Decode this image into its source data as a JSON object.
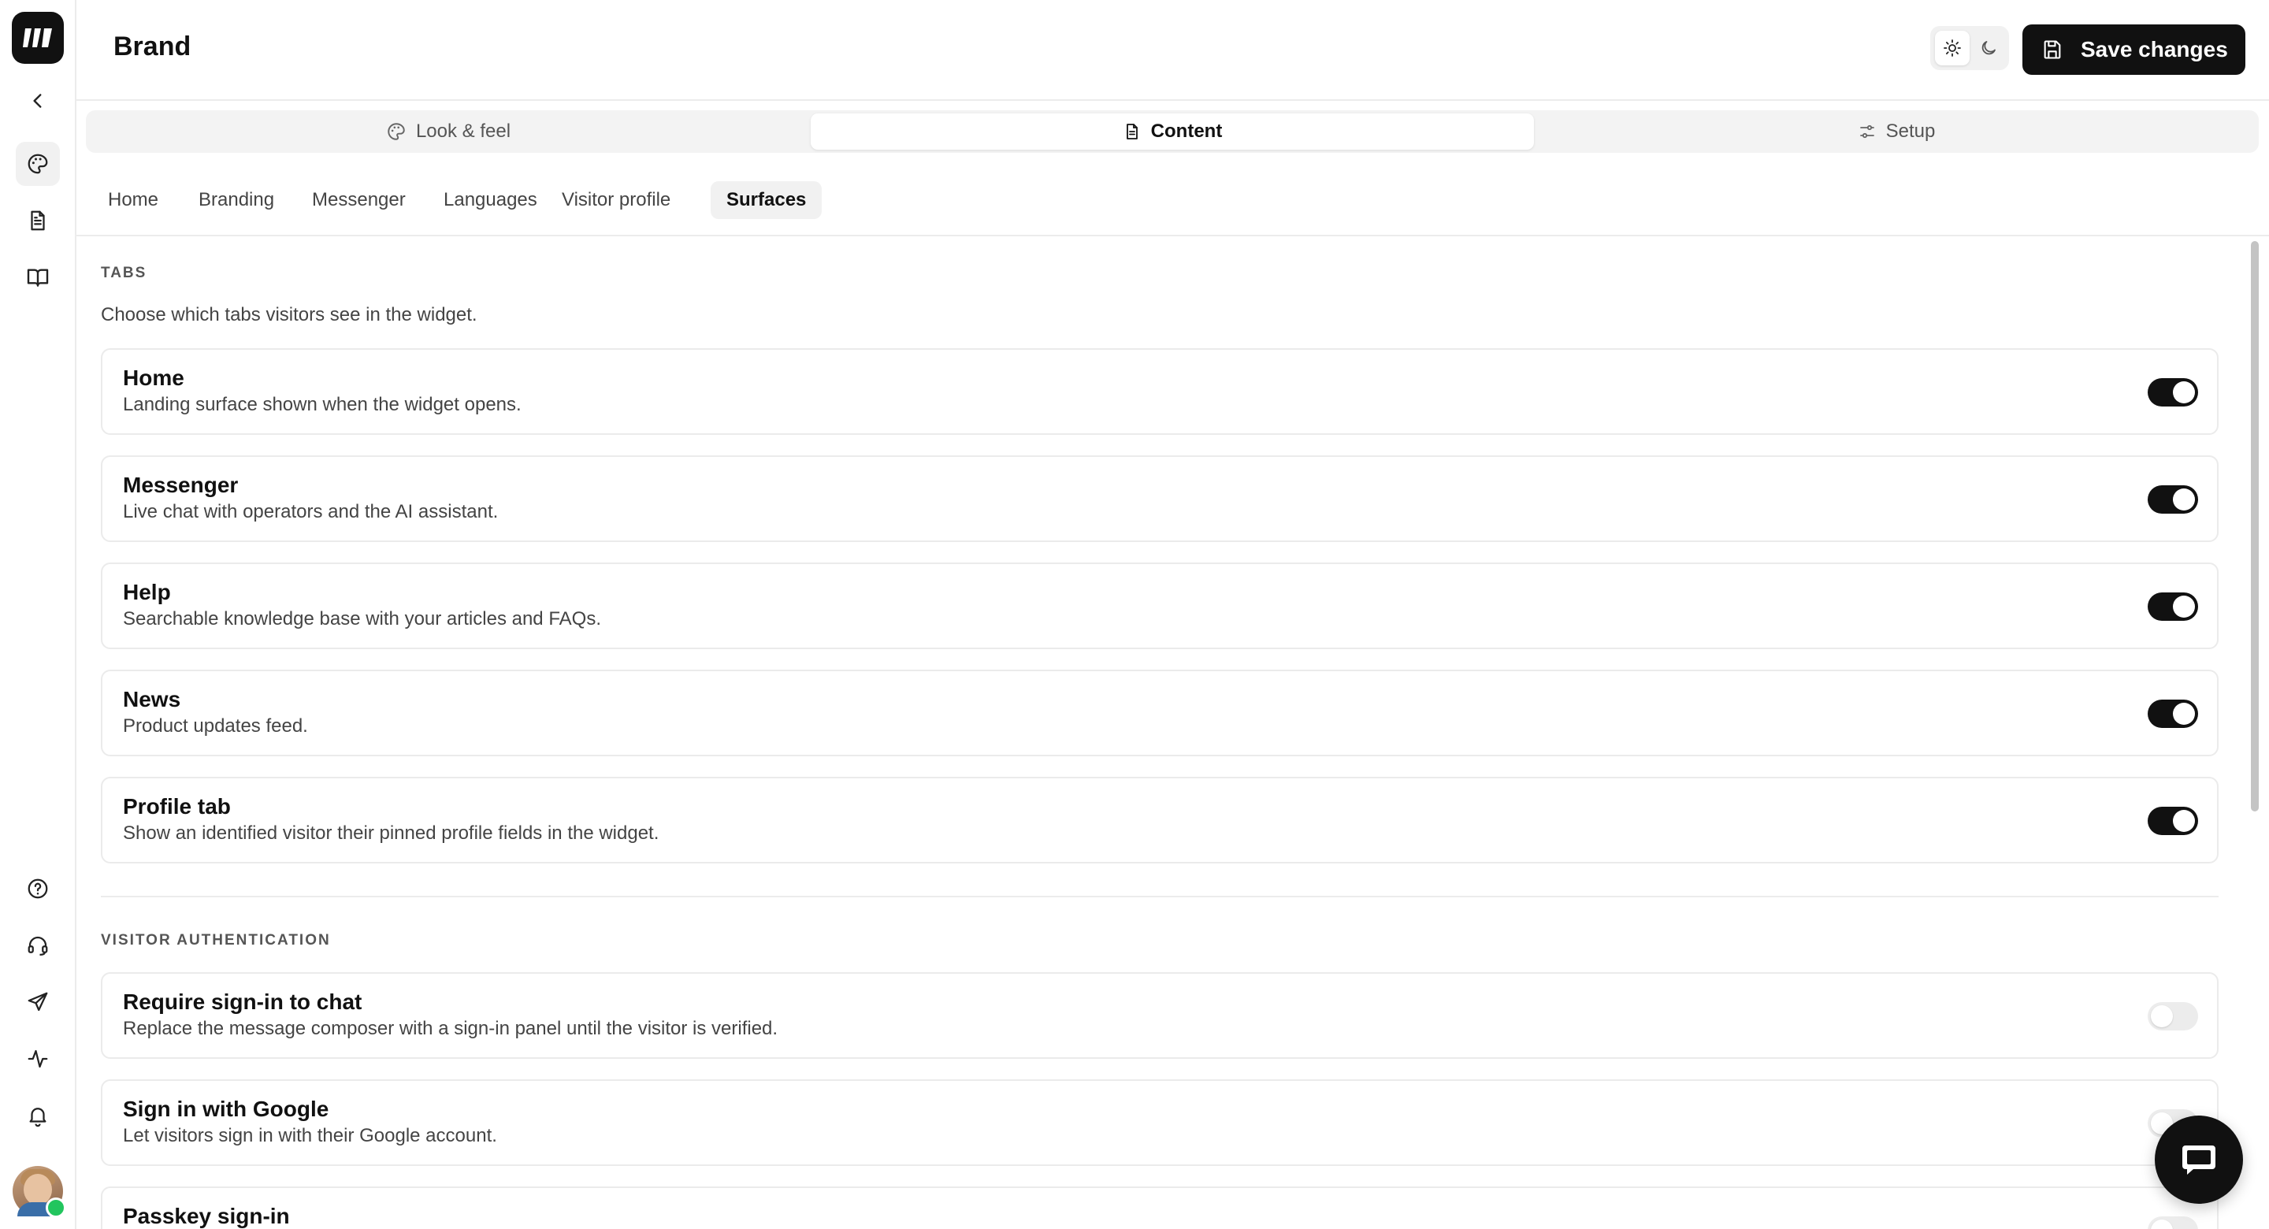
{
  "header": {
    "title": "Brand",
    "save_label": "Save changes",
    "theme": {
      "selected": "light"
    }
  },
  "main_tabs": [
    {
      "label": "Look & feel",
      "icon": "palette-icon",
      "active": false
    },
    {
      "label": "Content",
      "icon": "document-icon",
      "active": true
    },
    {
      "label": "Setup",
      "icon": "sliders-icon",
      "active": false
    }
  ],
  "sub_tabs": [
    {
      "label": "Home",
      "active": false
    },
    {
      "label": "Branding",
      "active": false
    },
    {
      "label": "Messenger",
      "active": false
    },
    {
      "label": "Languages",
      "active": false
    },
    {
      "label": "Visitor profile",
      "active": false
    },
    {
      "label": "Surfaces",
      "active": true
    }
  ],
  "sections": {
    "tabs": {
      "label": "TABS",
      "description": "Choose which tabs visitors see in the widget.",
      "items": [
        {
          "title": "Home",
          "description": "Landing surface shown when the widget opens.",
          "enabled": true
        },
        {
          "title": "Messenger",
          "description": "Live chat with operators and the AI assistant.",
          "enabled": true
        },
        {
          "title": "Help",
          "description": "Searchable knowledge base with your articles and FAQs.",
          "enabled": true
        },
        {
          "title": "News",
          "description": "Product updates feed.",
          "enabled": true
        },
        {
          "title": "Profile tab",
          "description": "Show an identified visitor their pinned profile fields in the widget.",
          "enabled": true
        }
      ]
    },
    "auth": {
      "label": "VISITOR AUTHENTICATION",
      "items": [
        {
          "title": "Require sign-in to chat",
          "description": "Replace the message composer with a sign-in panel until the visitor is verified.",
          "enabled": false
        },
        {
          "title": "Sign in with Google",
          "description": "Let visitors sign in with their Google account.",
          "enabled": false
        },
        {
          "title": "Passkey sign-in",
          "description": "",
          "enabled": false
        }
      ]
    }
  },
  "rail": {
    "top_icons": [
      "back-chevron-icon",
      "palette-icon",
      "document-icon",
      "book-icon"
    ],
    "bottom_icons": [
      "help-icon",
      "headset-icon",
      "send-icon",
      "activity-icon",
      "bell-icon"
    ],
    "active": "palette-icon",
    "status": "online"
  },
  "colors": {
    "accent": "#111111",
    "online": "#22c55e",
    "border": "#ebebeb"
  }
}
